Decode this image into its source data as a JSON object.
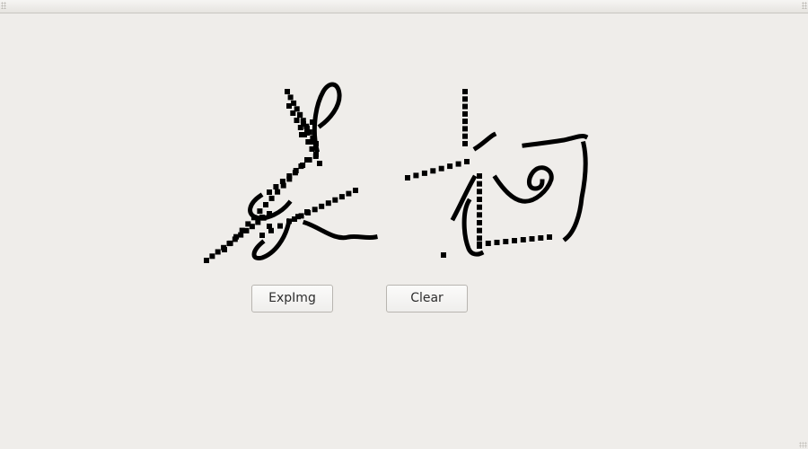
{
  "buttons": {
    "export_label": "ExpImg",
    "clear_label": "Clear"
  },
  "signature": {
    "ink_color": "#000000"
  },
  "background_color": "#efedea"
}
